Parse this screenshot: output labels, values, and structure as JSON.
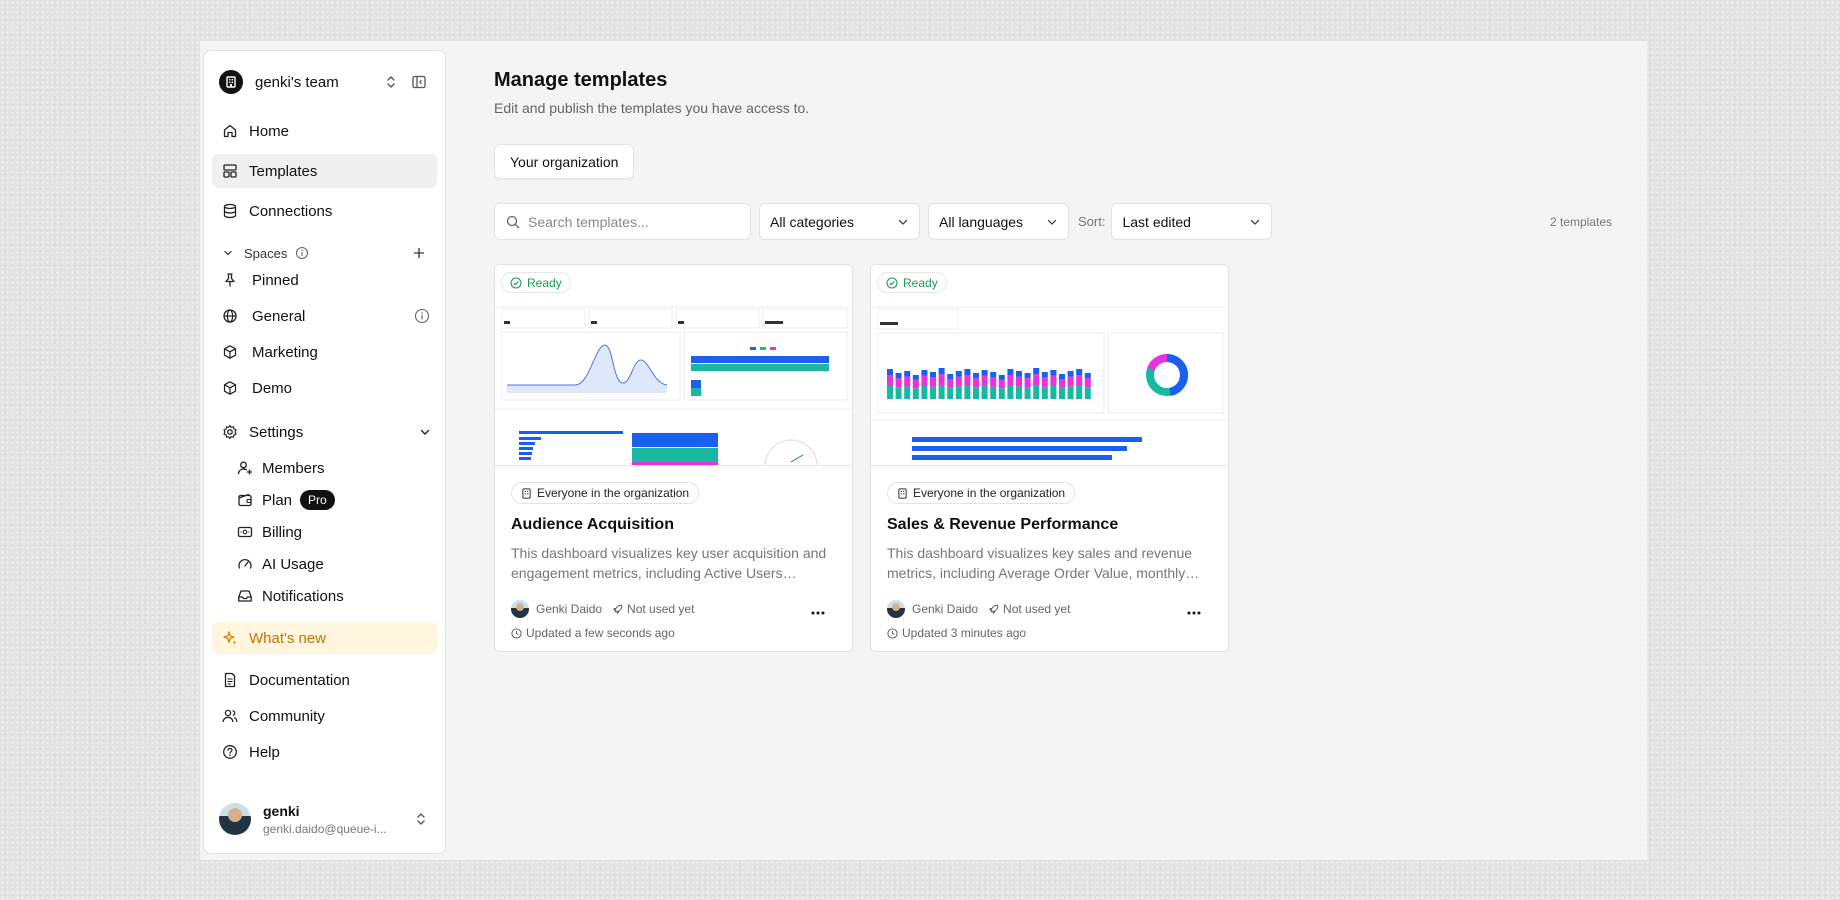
{
  "team": {
    "name": "genki's team"
  },
  "nav": {
    "home": "Home",
    "templates": "Templates",
    "connections": "Connections"
  },
  "spaces": {
    "label": "Spaces",
    "items": [
      {
        "label": "Pinned",
        "icon": "pin-icon"
      },
      {
        "label": "General",
        "icon": "globe-icon"
      },
      {
        "label": "Marketing",
        "icon": "cube-icon"
      },
      {
        "label": "Demo",
        "icon": "cube-icon"
      }
    ]
  },
  "settings": {
    "label": "Settings",
    "items": [
      {
        "label": "Members",
        "icon": "user-plus-icon"
      },
      {
        "label": "Plan",
        "icon": "wallet-icon",
        "badge": "Pro"
      },
      {
        "label": "Billing",
        "icon": "billing-icon"
      },
      {
        "label": "AI Usage",
        "icon": "gauge-icon"
      },
      {
        "label": "Notifications",
        "icon": "inbox-icon"
      }
    ]
  },
  "footer_nav": {
    "whats_new": "What's new",
    "documentation": "Documentation",
    "community": "Community",
    "help": "Help"
  },
  "user": {
    "name": "genki",
    "email": "genki.daido@queue-i..."
  },
  "main": {
    "title": "Manage templates",
    "subtitle": "Edit and publish the templates you have access to.",
    "tab": "Your organization",
    "search_placeholder": "Search templates...",
    "category_filter": "All categories",
    "language_filter": "All languages",
    "sort_label": "Sort:",
    "sort_value": "Last edited",
    "count": "2 templates"
  },
  "colors": {
    "accent_blue": "#1a5ff0",
    "accent_teal": "#19b8a0",
    "accent_magenta": "#e832e0",
    "ready_green": "#1e9c52",
    "whats_new_orange": "#c77400"
  },
  "cards": [
    {
      "status": "Ready",
      "access": "Everyone in the organization",
      "title": "Audience Acquisition",
      "description": "This dashboard visualizes key user acquisition and engagement metrics, including Active Users…",
      "author": "Genki Daido",
      "usage": "Not used yet",
      "updated": "Updated a few seconds ago"
    },
    {
      "status": "Ready",
      "access": "Everyone in the organization",
      "title": "Sales & Revenue Performance",
      "description": "This dashboard visualizes key sales and revenue metrics, including Average Order Value, monthly…",
      "author": "Genki Daido",
      "usage": "Not used yet",
      "updated": "Updated 3 minutes ago"
    }
  ]
}
